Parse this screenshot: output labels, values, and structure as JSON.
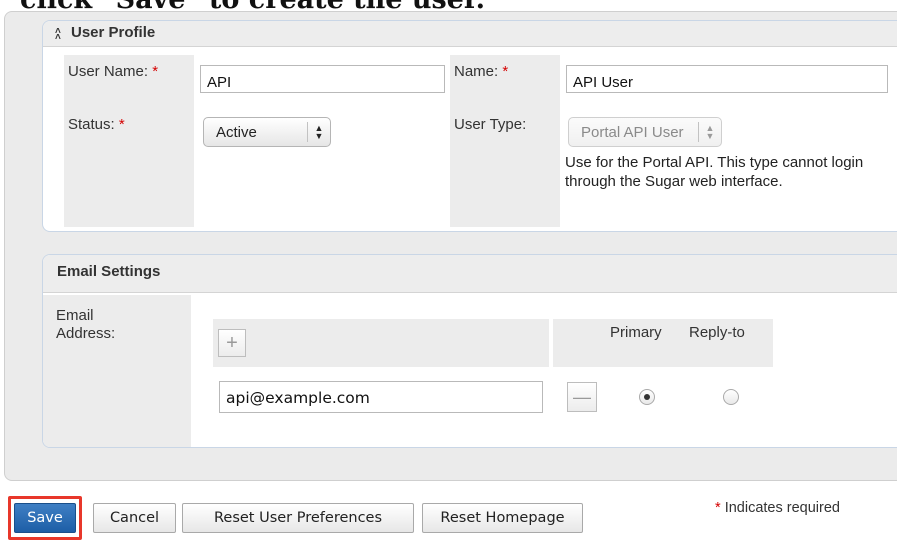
{
  "heading": "click \"Save\" to create the user.",
  "user_profile": {
    "collapse_icon": "double-chevron-up-icon",
    "title": "User Profile",
    "user_name_label": "User Name:",
    "user_name_value": "API",
    "name_label": "Name:",
    "name_value": "API User",
    "status_label": "Status:",
    "status_value": "Active",
    "user_type_label": "User Type:",
    "user_type_value": "Portal API User",
    "user_type_help": "Use for the Portal API. This type cannot login through the Sugar web interface.",
    "required_mark": "*"
  },
  "email_settings": {
    "title": "Email Settings",
    "email_address_label": "Email Address:",
    "add_symbol": "+",
    "remove_symbol": "—",
    "primary_header": "Primary",
    "reply_to_header": "Reply-to",
    "email_value": "api@example.com",
    "primary_checked": true,
    "reply_to_checked": false
  },
  "footer": {
    "save_label": "Save",
    "cancel_label": "Cancel",
    "reset_prefs_label": "Reset User Preferences",
    "reset_home_label": "Reset Homepage",
    "required_note_mark": "*",
    "required_note": "Indicates required"
  },
  "colors": {
    "save_button": "#2a6bb3",
    "highlight": "#e8372a",
    "required": "#d40000",
    "panel_border": "#c9d6e6"
  }
}
